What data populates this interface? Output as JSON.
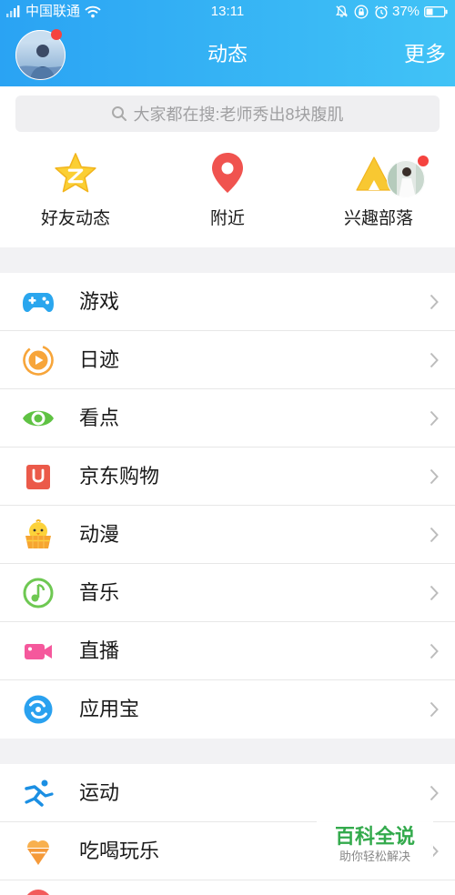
{
  "status_bar": {
    "carrier": "中国联通",
    "time": "13:11",
    "battery": "37%",
    "icons": [
      "signal-icon",
      "wifi-icon",
      "bell-off-icon",
      "rotation-lock-icon",
      "alarm-icon",
      "battery-icon"
    ]
  },
  "header": {
    "title": "动态",
    "more_label": "更多",
    "avatar_icon": "user-avatar"
  },
  "search": {
    "placeholder": "大家都在搜:老师秀出8块腹肌",
    "icon": "search-icon"
  },
  "quick_entries": [
    {
      "label": "好友动态",
      "icon": "star-z-icon"
    },
    {
      "label": "附近",
      "icon": "location-pin-icon"
    },
    {
      "label": "兴趣部落",
      "icon": "tent-icon"
    }
  ],
  "sections": [
    {
      "items": [
        {
          "label": "游戏",
          "icon": "gamepad-icon"
        },
        {
          "label": "日迹",
          "icon": "play-circle-icon"
        },
        {
          "label": "看点",
          "icon": "eye-icon"
        },
        {
          "label": "京东购物",
          "icon": "shopping-bag-icon"
        },
        {
          "label": "动漫",
          "icon": "chick-icon"
        },
        {
          "label": "音乐",
          "icon": "music-note-icon"
        },
        {
          "label": "直播",
          "icon": "video-camera-icon"
        },
        {
          "label": "应用宝",
          "icon": "app-store-icon"
        }
      ]
    },
    {
      "items": [
        {
          "label": "运动",
          "icon": "running-icon"
        },
        {
          "label": "吃喝玩乐",
          "icon": "ice-cream-icon"
        },
        {
          "icon": "red-app-icon"
        }
      ]
    }
  ],
  "watermark": {
    "title": "百科全说",
    "subtitle": "助你轻松解决"
  },
  "colors": {
    "header_gradient_start": "#2aa3f3",
    "header_gradient_end": "#41c3f6",
    "badge_dot": "#f5433f",
    "separator": "#f2f2f4",
    "list_divider": "#e7e7e7",
    "watermark_title": "#33aa4c"
  }
}
